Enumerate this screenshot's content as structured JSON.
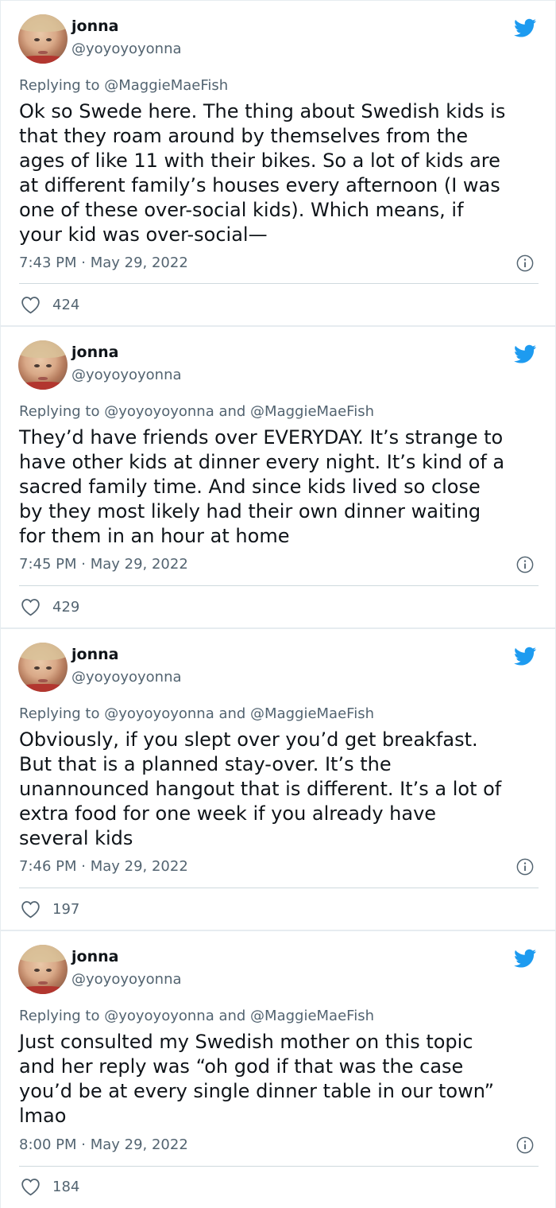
{
  "tweets": [
    {
      "name": "jonna",
      "handle": "@yoyoyoyonna",
      "replying_prefix": "Replying to",
      "replying_to": "@MaggieMaeFish",
      "body": "Ok so Swede here. The thing about Swedish kids is\nthat they roam around by themselves from the\nages of like 11 with their bikes. So a lot of kids are\nat different family’s houses every afternoon (I was\none of these over-social kids). Which means, if\nyour kid was over-social—",
      "timestamp": "7:43 PM · May 29, 2022",
      "likes": "424"
    },
    {
      "name": "jonna",
      "handle": "@yoyoyoyonna",
      "replying_prefix": "Replying to",
      "replying_to": "@yoyoyoyonna and @MaggieMaeFish",
      "body": "They’d have friends over EVERYDAY. It’s strange to\nhave other kids at dinner every night. It’s kind of a\nsacred family time. And since kids lived so close\nby they most likely had their own dinner waiting\nfor them in an hour at home",
      "timestamp": "7:45 PM · May 29, 2022",
      "likes": "429"
    },
    {
      "name": "jonna",
      "handle": "@yoyoyoyonna",
      "replying_prefix": "Replying to",
      "replying_to": "@yoyoyoyonna and @MaggieMaeFish",
      "body": "Obviously, if you slept over you’d get breakfast.\nBut that is a planned stay-over. It’s the\nunannounced hangout that is different. It’s a lot of\nextra food for one week if you already have\nseveral kids",
      "timestamp": "7:46 PM · May 29, 2022",
      "likes": "197"
    },
    {
      "name": "jonna",
      "handle": "@yoyoyoyonna",
      "replying_prefix": "Replying to",
      "replying_to": "@yoyoyoyonna and @MaggieMaeFish",
      "body": "Just consulted my Swedish mother on this topic\nand her reply was “oh god if that was the case\nyou’d be at every single dinner table in our town”\nlmao",
      "timestamp": "8:00 PM · May 29, 2022",
      "likes": "184"
    }
  ],
  "colors": {
    "twitter_blue": "#1d9bf0",
    "secondary_text": "#536471",
    "primary_text": "#0f1419",
    "divider": "#cfd9de",
    "page_bg": "#e6ecf0"
  },
  "icons": {
    "brand": "twitter-bird-icon",
    "info": "info-icon",
    "like": "heart-icon"
  }
}
